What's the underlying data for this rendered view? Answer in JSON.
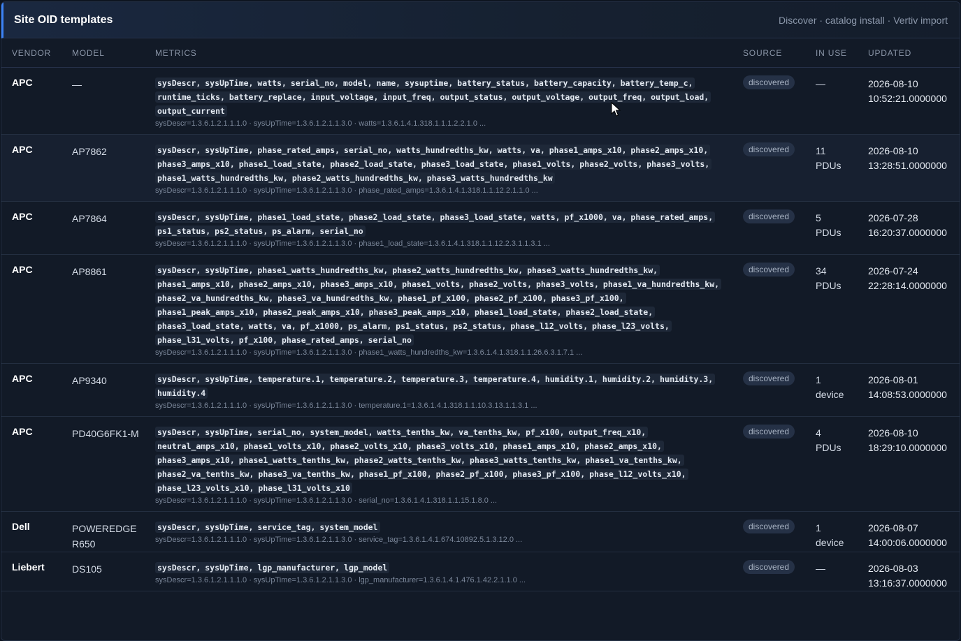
{
  "panel": {
    "title": "Site OID templates",
    "actions": "Discover · catalog install · Vertiv import"
  },
  "columns": {
    "vendor": "VENDOR",
    "model": "MODEL",
    "metrics": "METRICS",
    "source": "SOURCE",
    "in_use": "IN USE",
    "updated": "UPDATED"
  },
  "rows": [
    {
      "vendor": "APC",
      "model": "—",
      "metrics": "sysDescr, sysUpTime, watts, serial_no, model, name, sysuptime, battery_status, battery_capacity, battery_temp_c, runtime_ticks, battery_replace, input_voltage, input_freq, output_status, output_voltage, output_freq, output_load, output_current",
      "oids": "sysDescr=1.3.6.1.2.1.1.1.0 · sysUpTime=1.3.6.1.2.1.1.3.0 · watts=1.3.6.1.4.1.318.1.1.1.2.2.1.0 ...",
      "source": "discovered",
      "in_use_count": "—",
      "in_use_unit": "",
      "updated_date": "2026-08-10",
      "updated_time": "10:52:21.0000000"
    },
    {
      "vendor": "APC",
      "model": "AP7862",
      "metrics": "sysDescr, sysUpTime, phase_rated_amps, serial_no, watts_hundredths_kw, watts, va, phase1_amps_x10, phase2_amps_x10, phase3_amps_x10, phase1_load_state, phase2_load_state, phase3_load_state, phase1_volts, phase2_volts, phase3_volts, phase1_watts_hundredths_kw, phase2_watts_hundredths_kw, phase3_watts_hundredths_kw",
      "oids": "sysDescr=1.3.6.1.2.1.1.1.0 · sysUpTime=1.3.6.1.2.1.1.3.0 · phase_rated_amps=1.3.6.1.4.1.318.1.1.12.2.1.1.0 ...",
      "source": "discovered",
      "in_use_count": "11",
      "in_use_unit": "PDUs",
      "updated_date": "2026-08-10",
      "updated_time": "13:28:51.0000000"
    },
    {
      "vendor": "APC",
      "model": "AP7864",
      "metrics": "sysDescr, sysUpTime, phase1_load_state, phase2_load_state, phase3_load_state, watts, pf_x1000, va, phase_rated_amps, ps1_status, ps2_status, ps_alarm, serial_no",
      "oids": "sysDescr=1.3.6.1.2.1.1.1.0 · sysUpTime=1.3.6.1.2.1.1.3.0 · phase1_load_state=1.3.6.1.4.1.318.1.1.12.2.3.1.1.3.1 ...",
      "source": "discovered",
      "in_use_count": "5",
      "in_use_unit": "PDUs",
      "updated_date": "2026-07-28",
      "updated_time": "16:20:37.0000000"
    },
    {
      "vendor": "APC",
      "model": "AP8861",
      "metrics": "sysDescr, sysUpTime, phase1_watts_hundredths_kw, phase2_watts_hundredths_kw, phase3_watts_hundredths_kw, phase1_amps_x10, phase2_amps_x10, phase3_amps_x10, phase1_volts, phase2_volts, phase3_volts, phase1_va_hundredths_kw, phase2_va_hundredths_kw, phase3_va_hundredths_kw, phase1_pf_x100, phase2_pf_x100, phase3_pf_x100, phase1_peak_amps_x10, phase2_peak_amps_x10, phase3_peak_amps_x10, phase1_load_state, phase2_load_state, phase3_load_state, watts, va, pf_x1000, ps_alarm, ps1_status, ps2_status, phase_l12_volts, phase_l23_volts, phase_l31_volts, pf_x100, phase_rated_amps, serial_no",
      "oids": "sysDescr=1.3.6.1.2.1.1.1.0 · sysUpTime=1.3.6.1.2.1.1.3.0 · phase1_watts_hundredths_kw=1.3.6.1.4.1.318.1.1.26.6.3.1.7.1 ...",
      "source": "discovered",
      "in_use_count": "34",
      "in_use_unit": "PDUs",
      "updated_date": "2026-07-24",
      "updated_time": "22:28:14.0000000"
    },
    {
      "vendor": "APC",
      "model": "AP9340",
      "metrics": "sysDescr, sysUpTime, temperature.1, temperature.2, temperature.3, temperature.4, humidity.1, humidity.2, humidity.3, humidity.4",
      "oids": "sysDescr=1.3.6.1.2.1.1.1.0 · sysUpTime=1.3.6.1.2.1.1.3.0 · temperature.1=1.3.6.1.4.1.318.1.1.10.3.13.1.1.3.1 ...",
      "source": "discovered",
      "in_use_count": "1",
      "in_use_unit": "device",
      "updated_date": "2026-08-01",
      "updated_time": "14:08:53.0000000"
    },
    {
      "vendor": "APC",
      "model": "PD40G6FK1-M",
      "metrics": "sysDescr, sysUpTime, serial_no, system_model, watts_tenths_kw, va_tenths_kw, pf_x100, output_freq_x10, neutral_amps_x10, phase1_volts_x10, phase2_volts_x10, phase3_volts_x10, phase1_amps_x10, phase2_amps_x10, phase3_amps_x10, phase1_watts_tenths_kw, phase2_watts_tenths_kw, phase3_watts_tenths_kw, phase1_va_tenths_kw, phase2_va_tenths_kw, phase3_va_tenths_kw, phase1_pf_x100, phase2_pf_x100, phase3_pf_x100, phase_l12_volts_x10, phase_l23_volts_x10, phase_l31_volts_x10",
      "oids": "sysDescr=1.3.6.1.2.1.1.1.0 · sysUpTime=1.3.6.1.2.1.1.3.0 · serial_no=1.3.6.1.4.1.318.1.1.15.1.8.0 ...",
      "source": "discovered",
      "in_use_count": "4",
      "in_use_unit": "PDUs",
      "updated_date": "2026-08-10",
      "updated_time": "18:29:10.0000000"
    },
    {
      "vendor": "Dell",
      "model": "POWEREDGE R650",
      "metrics": "sysDescr, sysUpTime, service_tag, system_model",
      "oids": "sysDescr=1.3.6.1.2.1.1.1.0 · sysUpTime=1.3.6.1.2.1.1.3.0 · service_tag=1.3.6.1.4.1.674.10892.5.1.3.12.0 ...",
      "source": "discovered",
      "in_use_count": "1",
      "in_use_unit": "device",
      "updated_date": "2026-08-07",
      "updated_time": "14:00:06.0000000"
    },
    {
      "vendor": "Liebert",
      "model": "DS105",
      "metrics": "sysDescr, sysUpTime, lgp_manufacturer, lgp_model",
      "oids": "sysDescr=1.3.6.1.2.1.1.1.0 · sysUpTime=1.3.6.1.2.1.1.3.0 · lgp_manufacturer=1.3.6.1.4.1.476.1.42.2.1.1.0 ...",
      "source": "discovered",
      "in_use_count": "—",
      "in_use_unit": "",
      "updated_date": "2026-08-03",
      "updated_time": "13:16:37.0000000"
    }
  ]
}
